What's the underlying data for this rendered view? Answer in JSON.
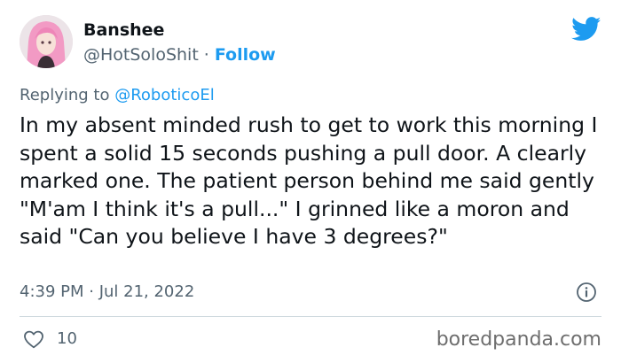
{
  "author": {
    "display_name": "Banshee",
    "handle": "@HotSoloShit",
    "separator": "·",
    "follow_label": "Follow"
  },
  "reply": {
    "prefix": "Replying to",
    "mention": "@RoboticoEl"
  },
  "tweet": {
    "text": "In my absent minded rush to get to work this morning I spent a solid 15 seconds pushing a pull door. A clearly marked one. The patient person behind me said gently \"M'am I think it's a pull...\" I grinned like a moron and said \"Can you believe I have 3 degrees?\"",
    "timestamp": "4:39 PM · Jul 21, 2022"
  },
  "actions": {
    "like_count": "10"
  },
  "watermark": "boredpanda.com",
  "icons": [
    "twitter-bird-icon",
    "info-icon",
    "heart-icon"
  ],
  "colors": {
    "accent": "#1d9bf0",
    "text": "#0f1419",
    "secondary": "#536471",
    "heart": "#f91880"
  }
}
